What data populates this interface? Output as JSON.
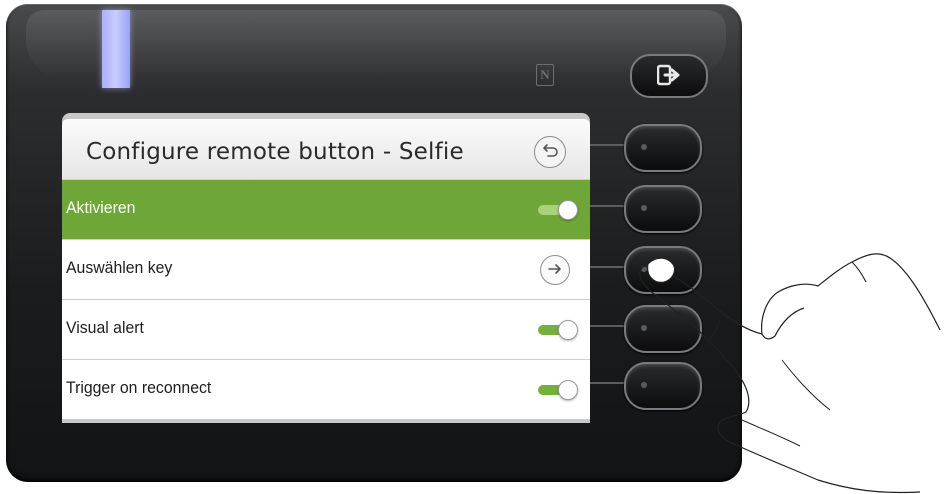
{
  "header": {
    "title": "Configure remote button - Selfie",
    "back_icon": "back-arrow-icon"
  },
  "menu": {
    "items": [
      {
        "label": "Aktivieren",
        "control": "toggle",
        "on": true,
        "selected": true
      },
      {
        "label": "Auswählen key",
        "control": "arrow",
        "selected": false
      },
      {
        "label": "Visual alert",
        "control": "toggle",
        "on": true,
        "selected": false
      },
      {
        "label": "Trigger on reconnect",
        "control": "toggle",
        "on": true,
        "selected": false
      }
    ]
  },
  "device": {
    "nfc_icon": "nfc-icon",
    "exit_icon": "exit-arrow-icon",
    "led_color": "#c9ccff"
  },
  "colors": {
    "selected_row": "#6ea737",
    "toggle_on": "#73b03c"
  }
}
